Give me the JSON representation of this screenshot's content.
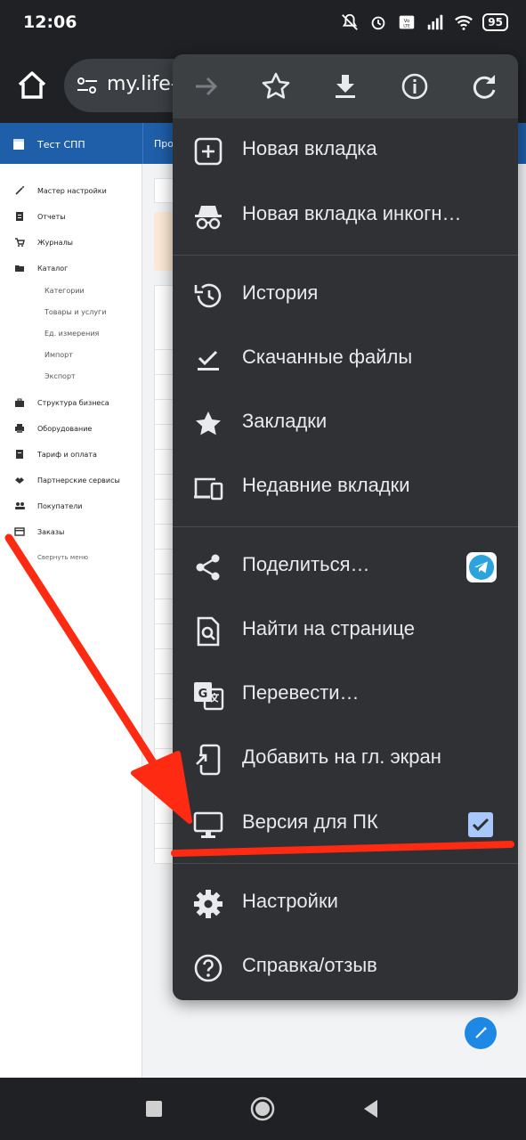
{
  "status_bar": {
    "time": "12:06",
    "battery": "95",
    "icons": [
      "mute-bell-icon",
      "alarm-icon",
      "volte-icon",
      "signal-icon",
      "wifi-icon"
    ]
  },
  "browser": {
    "url": "my.life-"
  },
  "webpage": {
    "header_title": "Тест СПП",
    "header_tab": "Про",
    "sidebar_items": [
      {
        "label": "Мастер настройки",
        "icon": "wand-icon"
      },
      {
        "label": "Отчеты",
        "icon": "report-icon"
      },
      {
        "label": "Журналы",
        "icon": "cart-icon"
      },
      {
        "label": "Каталог",
        "icon": "folder-icon"
      }
    ],
    "sidebar_sub": [
      "Категории",
      "Товары и услуги",
      "Ед. измерения",
      "Импорт",
      "Экспорт"
    ],
    "sidebar_items2": [
      {
        "label": "Структура бизнеса",
        "icon": "briefcase-icon"
      },
      {
        "label": "Оборудование",
        "icon": "printer-icon"
      },
      {
        "label": "Тариф и оплата",
        "icon": "receipt-icon"
      },
      {
        "label": "Партнерские сервисы",
        "icon": "handshake-icon"
      },
      {
        "label": "Покупатели",
        "icon": "people-icon"
      },
      {
        "label": "Заказы",
        "icon": "card-icon"
      },
      {
        "label": "Свернуть меню",
        "icon": "collapse-icon"
      }
    ]
  },
  "menu": {
    "top_icons": [
      "forward-icon",
      "star-outline-icon",
      "download-icon",
      "info-icon",
      "refresh-icon"
    ],
    "items": [
      {
        "label": "Новая вкладка",
        "icon": "plus-box-icon"
      },
      {
        "label": "Новая вкладка инкогн…",
        "icon": "incognito-icon"
      },
      {
        "label": "История",
        "icon": "history-icon"
      },
      {
        "label": "Скачанные файлы",
        "icon": "check-download-icon"
      },
      {
        "label": "Закладки",
        "icon": "star-icon"
      },
      {
        "label": "Недавние вкладки",
        "icon": "devices-icon"
      },
      {
        "label": "Поделиться…",
        "icon": "share-icon"
      },
      {
        "label": "Найти на странице",
        "icon": "find-page-icon"
      },
      {
        "label": "Перевести…",
        "icon": "translate-icon"
      },
      {
        "label": "Добавить на гл. экран",
        "icon": "add-home-icon"
      },
      {
        "label": "Версия для ПК",
        "icon": "desktop-icon",
        "checked": true
      },
      {
        "label": "Настройки",
        "icon": "gear-icon"
      },
      {
        "label": "Справка/отзыв",
        "icon": "help-icon"
      }
    ]
  },
  "colors": {
    "menu_bg": "#303134",
    "menu_top_bg": "#3c4043",
    "accent_check": "#a8c7fa",
    "annotation_red": "#ff2a12",
    "page_header": "#1f5ea8"
  }
}
